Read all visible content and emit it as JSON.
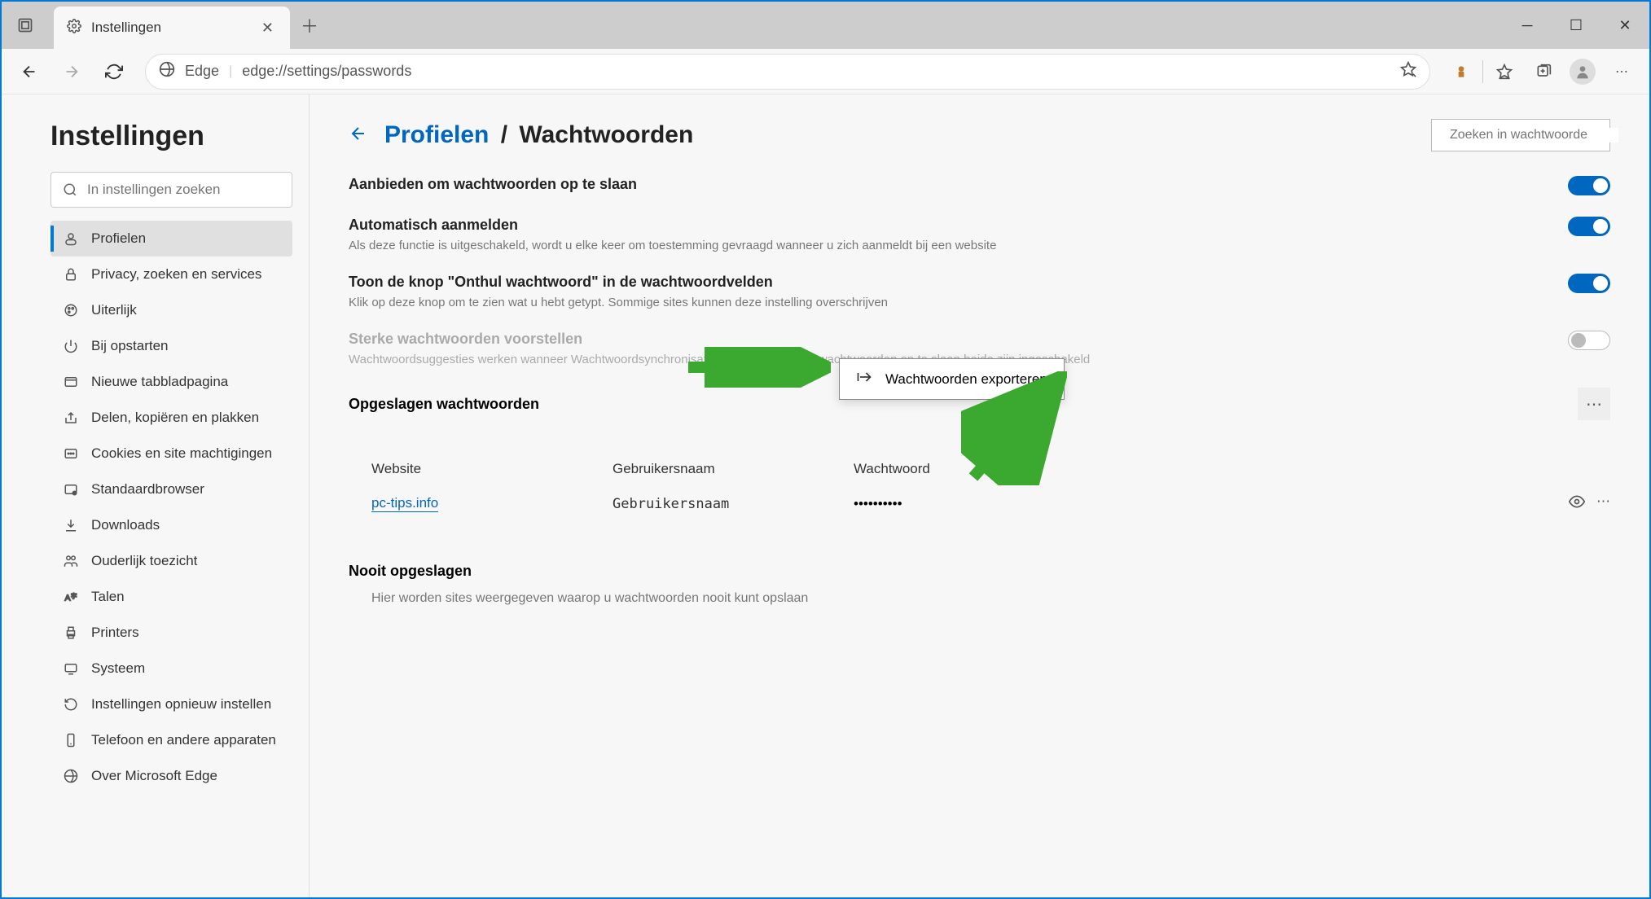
{
  "tab": {
    "title": "Instellingen"
  },
  "addressbar": {
    "browser": "Edge",
    "url": "edge://settings/passwords"
  },
  "sidebar": {
    "heading": "Instellingen",
    "search_placeholder": "In instellingen zoeken",
    "items": [
      {
        "label": "Profielen",
        "icon": "user"
      },
      {
        "label": "Privacy, zoeken en services",
        "icon": "lock"
      },
      {
        "label": "Uiterlijk",
        "icon": "brush"
      },
      {
        "label": "Bij opstarten",
        "icon": "power"
      },
      {
        "label": "Nieuwe tabbladpagina",
        "icon": "tab"
      },
      {
        "label": "Delen, kopiëren en plakken",
        "icon": "share"
      },
      {
        "label": "Cookies en site machtigingen",
        "icon": "cookie"
      },
      {
        "label": "Standaardbrowser",
        "icon": "browser"
      },
      {
        "label": "Downloads",
        "icon": "download"
      },
      {
        "label": "Ouderlijk toezicht",
        "icon": "family"
      },
      {
        "label": "Talen",
        "icon": "lang"
      },
      {
        "label": "Printers",
        "icon": "printer"
      },
      {
        "label": "Systeem",
        "icon": "system"
      },
      {
        "label": "Instellingen opnieuw instellen",
        "icon": "reset"
      },
      {
        "label": "Telefoon en andere apparaten",
        "icon": "phone"
      },
      {
        "label": "Over Microsoft Edge",
        "icon": "edge"
      }
    ]
  },
  "breadcrumb": {
    "parent": "Profielen",
    "current": "Wachtwoorden"
  },
  "main_search_placeholder": "Zoeken in wachtwoorde",
  "settings": {
    "offer_save": {
      "title": "Aanbieden om wachtwoorden op te slaan"
    },
    "auto_signin": {
      "title": "Automatisch aanmelden",
      "desc": "Als deze functie is uitgeschakeld, wordt u elke keer om toestemming gevraagd wanneer u zich aanmeldt bij een website"
    },
    "reveal": {
      "title": "Toon de knop \"Onthul wachtwoord\" in de wachtwoordvelden",
      "desc": "Klik op deze knop om te zien wat u hebt getypt. Sommige sites kunnen deze instelling overschrijven"
    },
    "suggest_strong": {
      "title": "Sterke wachtwoorden voorstellen",
      "desc": "Wachtwoordsuggesties werken wanneer Wachtwoordsynchronisatie en Aanbieden om wachtwoorden op te slaan beide zijn ingeschakeld"
    }
  },
  "saved_pw": {
    "heading": "Opgeslagen wachtwoorden",
    "columns": {
      "site": "Website",
      "user": "Gebruikersnaam",
      "pw": "Wachtwoord"
    },
    "rows": [
      {
        "site": "pc-tips.info",
        "user": "Gebruikersnaam",
        "pw": "••••••••••"
      }
    ]
  },
  "export_menu": {
    "label": "Wachtwoorden exporteren"
  },
  "never_saved": {
    "heading": "Nooit opgeslagen",
    "desc": "Hier worden sites weergegeven waarop u wachtwoorden nooit kunt opslaan"
  }
}
